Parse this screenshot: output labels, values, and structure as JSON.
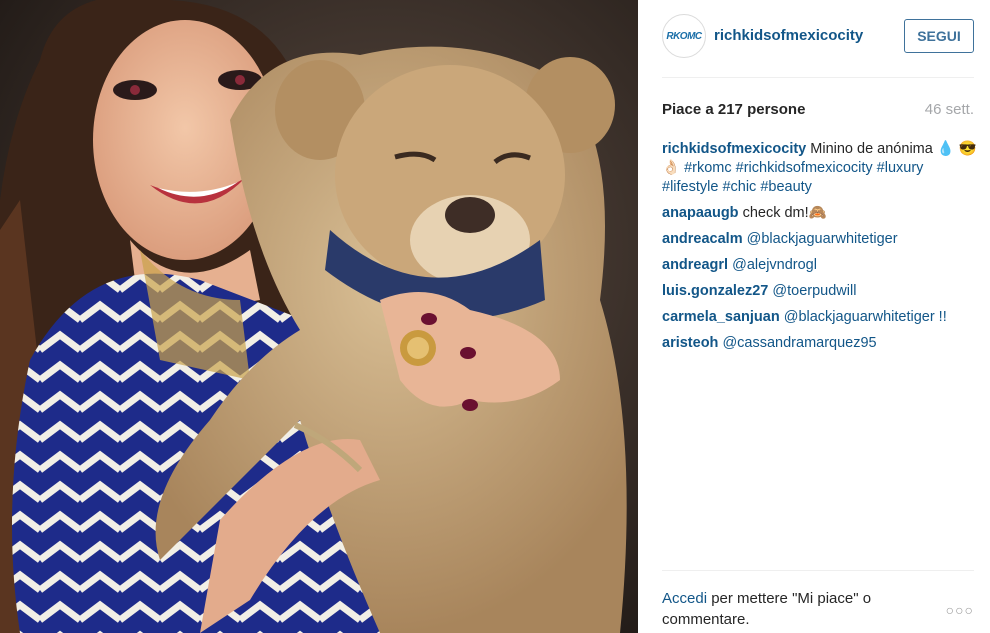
{
  "post": {
    "username": "richkidsofmexicocity",
    "avatar_text": "RKOMC",
    "follow_label": "SEGUI",
    "likes": "Piace a 217 persone",
    "time": "46 sett.",
    "caption": {
      "user": "richkidsofmexicocity",
      "text": "Minino de anónima 💧 😎👌🏻 ",
      "tags": "#rkomc #richkidsofmexicocity #luxury #lifestyle #chic #beauty"
    },
    "comments": [
      {
        "user": "anapaaugb",
        "text": "check dm!🙈"
      },
      {
        "user": "andreacalm",
        "text": "@blackjaguarwhitetiger"
      },
      {
        "user": "andreagrl",
        "text": "@alejvndrogl"
      },
      {
        "user": "luis.gonzalez27",
        "text": "@toerpudwill"
      },
      {
        "user": "carmela_sanjuan",
        "text": "@blackjaguarwhitetiger !!"
      },
      {
        "user": "aristeoh",
        "text": "@cassandramarquez95"
      }
    ],
    "footer": {
      "login": "Accedi",
      "rest": " per mettere \"Mi piace\" o commentare."
    },
    "more_label": "○○○"
  }
}
